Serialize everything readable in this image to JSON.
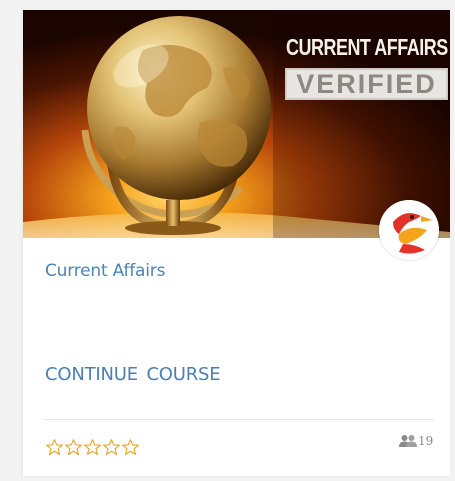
{
  "course_card": {
    "banner": {
      "headline_line1": "CURRENT AFFAIRS",
      "headline_line2": "VERIFIED",
      "image_subject": "globe-on-stand",
      "logo": "bird-logo"
    },
    "title": "Current Affairs",
    "action_label": "CONTINUE  COURSE",
    "rating": {
      "filled_stars": 0,
      "max_stars": 5
    },
    "enrolled": {
      "icon": "users-icon",
      "count": "19"
    }
  },
  "colors": {
    "link_blue": "#4e83b6",
    "star_outline": "#e3a628",
    "banner_glow": "#f5a21b",
    "logo_red": "#e2322a",
    "logo_orange": "#f4a41c"
  }
}
